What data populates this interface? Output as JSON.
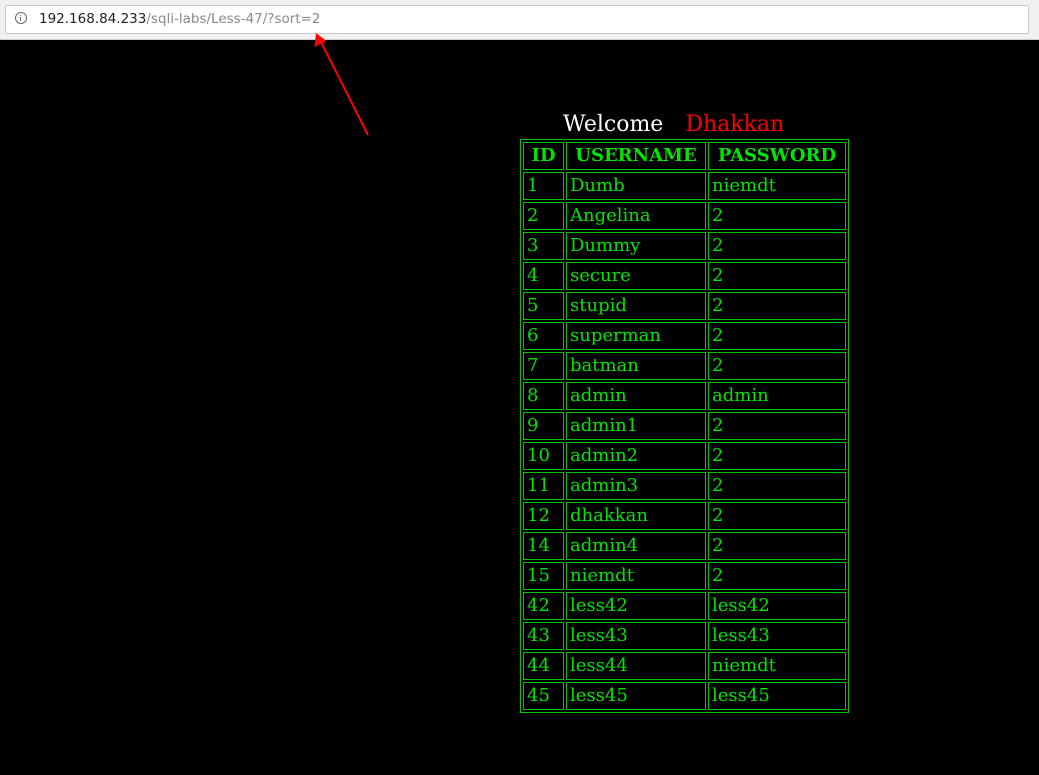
{
  "browser": {
    "url_host": "192.168.84.233",
    "url_path": "/sqli-labs/Less-47/?sort=2"
  },
  "page": {
    "welcome_label": "Welcome",
    "user_name": "Dhakkan"
  },
  "colors": {
    "background": "#000000",
    "table_text": "#00e600",
    "welcome": "#ffffff",
    "name": "#ff0000",
    "annotation_arrow": "#ff0000"
  },
  "table": {
    "headers": [
      "ID",
      "USERNAME",
      "PASSWORD"
    ],
    "rows": [
      [
        "1",
        "Dumb",
        "niemdt"
      ],
      [
        "2",
        "Angelina",
        "2"
      ],
      [
        "3",
        "Dummy",
        "2"
      ],
      [
        "4",
        "secure",
        "2"
      ],
      [
        "5",
        "stupid",
        "2"
      ],
      [
        "6",
        "superman",
        "2"
      ],
      [
        "7",
        "batman",
        "2"
      ],
      [
        "8",
        "admin",
        "admin"
      ],
      [
        "9",
        "admin1",
        "2"
      ],
      [
        "10",
        "admin2",
        "2"
      ],
      [
        "11",
        "admin3",
        "2"
      ],
      [
        "12",
        "dhakkan",
        "2"
      ],
      [
        "14",
        "admin4",
        "2"
      ],
      [
        "15",
        "niemdt",
        "2"
      ],
      [
        "42",
        "less42",
        "less42"
      ],
      [
        "43",
        "less43",
        "less43"
      ],
      [
        "44",
        "less44",
        "niemdt"
      ],
      [
        "45",
        "less45",
        "less45"
      ]
    ]
  }
}
